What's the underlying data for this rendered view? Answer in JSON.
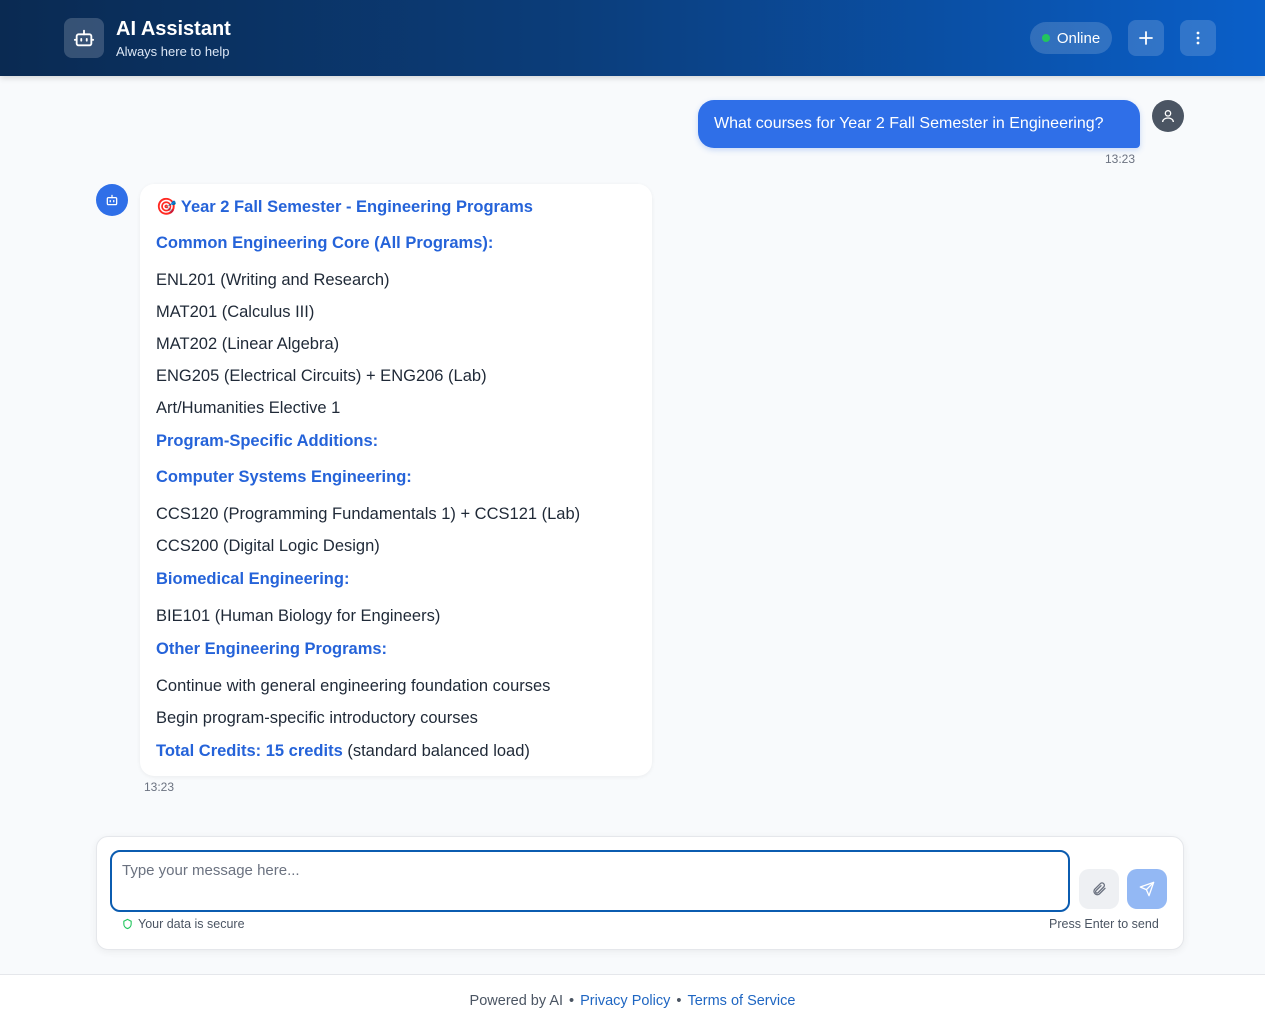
{
  "header": {
    "title": "AI Assistant",
    "subtitle": "Always here to help",
    "status": "Online",
    "new_chat_icon": "plus-icon",
    "menu_icon": "more-vertical-icon",
    "brand_icon": "robot-icon"
  },
  "colors": {
    "accent": "#2f6fe8",
    "heading": "#2563d9",
    "status_online": "#22c55e"
  },
  "conversation": {
    "user_message": {
      "text": "What courses for Year 2 Fall Semester in Engineering?",
      "time": "13:23"
    },
    "bot_message": {
      "title_emoji": "🎯",
      "title": "Year 2 Fall Semester - Engineering Programs",
      "core_heading": "Common Engineering Core (All Programs):",
      "core_items": [
        "ENL201 (Writing and Research)",
        "MAT201 (Calculus III)",
        "MAT202 (Linear Algebra)",
        "ENG205 (Electrical Circuits) + ENG206 (Lab)",
        "Art/Humanities Elective 1"
      ],
      "program_heading": "Program-Specific Additions:",
      "cse_heading": "Computer Systems Engineering:",
      "cse_items": [
        "CCS120 (Programming Fundamentals 1) + CCS121 (Lab)",
        "CCS200 (Digital Logic Design)"
      ],
      "bio_heading": "Biomedical Engineering:",
      "bio_items": [
        "BIE101 (Human Biology for Engineers)"
      ],
      "other_heading": "Other Engineering Programs:",
      "other_items": [
        "Continue with general engineering foundation courses",
        "Begin program-specific introductory courses"
      ],
      "total_label": "Total Credits: 15 credits",
      "total_note": "(standard balanced load)",
      "time": "13:23"
    }
  },
  "composer": {
    "placeholder": "Type your message here...",
    "secure_text": "Your data is secure",
    "hint": "Press Enter to send",
    "attach_icon": "paperclip-icon",
    "send_icon": "send-icon"
  },
  "footer": {
    "powered": "Powered by AI",
    "sep": "•",
    "privacy": "Privacy Policy",
    "terms": "Terms of Service"
  }
}
